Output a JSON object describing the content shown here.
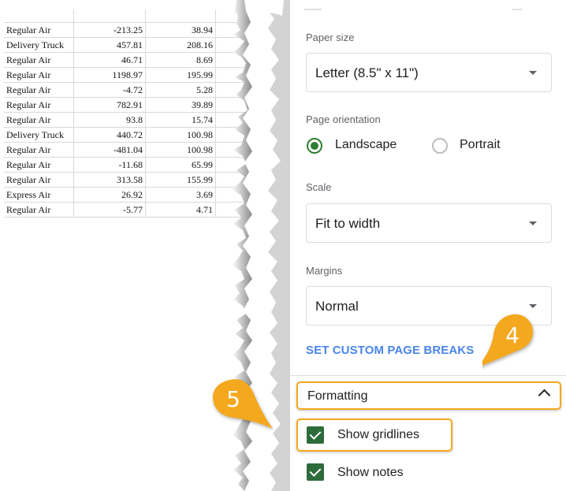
{
  "spreadsheet": {
    "rows": [
      [
        "Regular Air",
        "-213.25",
        "38.94"
      ],
      [
        "Delivery Truck",
        "457.81",
        "208.16"
      ],
      [
        "Regular Air",
        "46.71",
        "8.69"
      ],
      [
        "Regular Air",
        "1198.97",
        "195.99"
      ],
      [
        "Regular Air",
        "-4.72",
        "5.28"
      ],
      [
        "Regular Air",
        "782.91",
        "39.89"
      ],
      [
        "Regular Air",
        "93.8",
        "15.74"
      ],
      [
        "Delivery Truck",
        "440.72",
        "100.98"
      ],
      [
        "Regular Air",
        "-481.04",
        "100.98"
      ],
      [
        "Regular Air",
        "-11.68",
        "65.99"
      ],
      [
        "Regular Air",
        "313.58",
        "155.99"
      ],
      [
        "Express Air",
        "26.92",
        "3.69"
      ],
      [
        "Regular Air",
        "-5.77",
        "4.71"
      ]
    ]
  },
  "panel": {
    "paper_size": {
      "label": "Paper size",
      "value": "Letter (8.5\" x 11\")"
    },
    "orientation": {
      "label": "Page orientation",
      "options": [
        {
          "label": "Landscape",
          "selected": true
        },
        {
          "label": "Portrait",
          "selected": false
        }
      ]
    },
    "scale": {
      "label": "Scale",
      "value": "Fit to width"
    },
    "margins": {
      "label": "Margins",
      "value": "Normal"
    },
    "custom_breaks_link": "SET CUSTOM PAGE BREAKS",
    "formatting": {
      "label": "Formatting",
      "expanded": true,
      "checkboxes": [
        {
          "label": "Show gridlines",
          "checked": true
        },
        {
          "label": "Show notes",
          "checked": true
        }
      ]
    }
  },
  "callouts": [
    {
      "number": "4",
      "color": "#f4a81d"
    },
    {
      "number": "5",
      "color": "#f4a81d"
    }
  ],
  "colors": {
    "accent_green": "#2e7d32",
    "link_blue": "#4a86e8",
    "highlight_orange": "#f4a81d"
  }
}
